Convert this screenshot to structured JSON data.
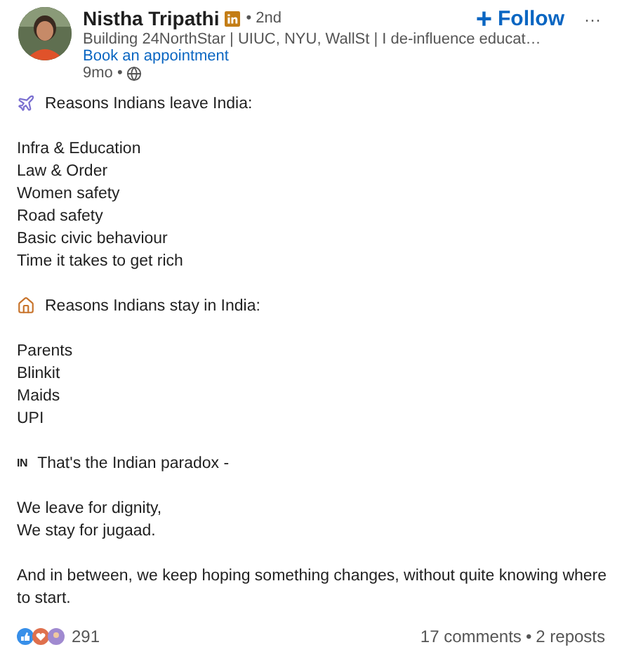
{
  "author": {
    "name": "Nistha Tripathi",
    "degree": "• 2nd",
    "headline": "Building 24NorthStar | UIUC, NYU, WallSt | I de-influence educat…",
    "link": "Book an appointment",
    "time": "9mo •"
  },
  "follow": {
    "icon": "+",
    "label": "Follow"
  },
  "more": "···",
  "blocks": [
    {
      "kind": "departure",
      "lines": [
        "Reasons Indians leave India:"
      ]
    },
    {
      "kind": "lines",
      "lines": [
        "Infra & Education",
        "Law & Order",
        "Women safety",
        "Road safety",
        "Basic civic behaviour",
        "Time it takes to get rich"
      ]
    },
    {
      "kind": "home",
      "lines": [
        "Reasons Indians stay in India:"
      ]
    },
    {
      "kind": "lines",
      "lines": [
        "Parents",
        "Blinkit",
        "Maids",
        "UPI"
      ]
    },
    {
      "kind": "flag",
      "flag": "IN",
      "lines": [
        "That's the Indian paradox -"
      ]
    },
    {
      "kind": "lines",
      "lines": [
        "We leave for dignity,",
        "We stay for jugaad."
      ]
    },
    {
      "kind": "lines",
      "lines": [
        "And in between, we keep hoping something changes, without quite knowing where to start."
      ]
    }
  ],
  "social": {
    "reactions": "291",
    "comments": "17 comments",
    "separator": "•",
    "reposts": "2 reposts"
  }
}
